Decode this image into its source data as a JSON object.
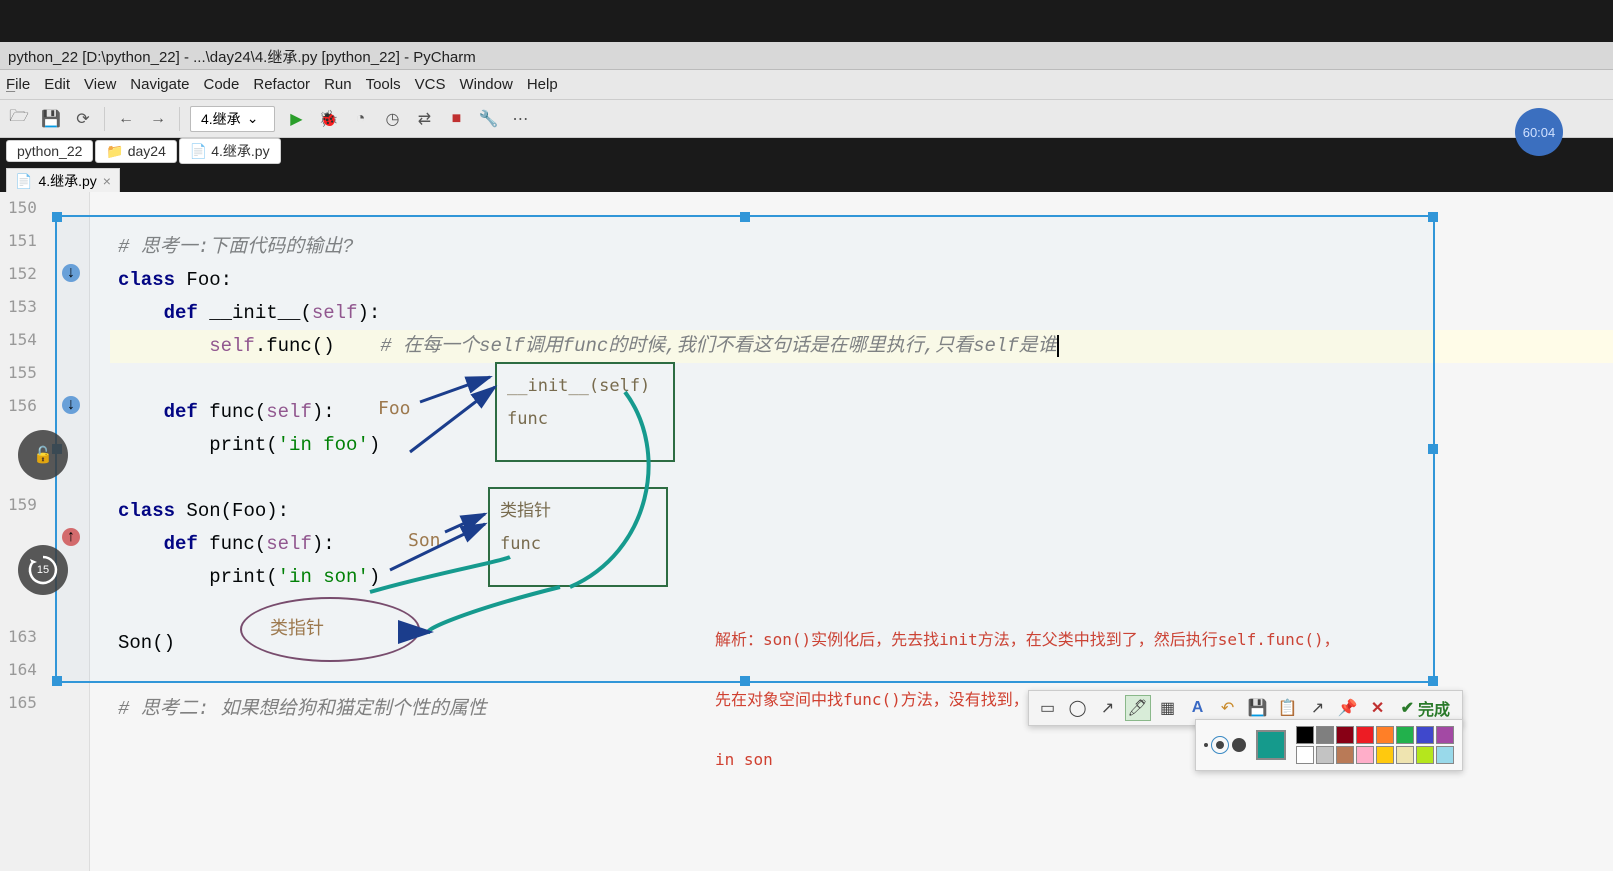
{
  "window": {
    "title": "python_22 [D:\\python_22] - ...\\day24\\4.继承.py [python_22] - PyCharm"
  },
  "menu": {
    "file": "File",
    "edit": "Edit",
    "view": "View",
    "navigate": "Navigate",
    "code": "Code",
    "refactor": "Refactor",
    "run": "Run",
    "tools": "Tools",
    "vcs": "VCS",
    "window": "Window",
    "help": "Help"
  },
  "toolbar": {
    "run_config": "4.继承"
  },
  "badge": {
    "time": "60:04"
  },
  "breadcrumbs": {
    "items": [
      "python_22",
      "day24",
      "4.继承.py"
    ]
  },
  "tabs": {
    "active": "4.继承.py"
  },
  "dim_label": "1132 × 386",
  "gutter_lines": [
    "150",
    "151",
    "152",
    "153",
    "154",
    "155",
    "156",
    "",
    "",
    "159",
    "",
    "",
    "",
    "163",
    "164",
    "165"
  ],
  "code": {
    "comment_think1": "# 思考一:下面代码的输出?",
    "class_foo": "class Foo:",
    "def_init": "    def __init__(self):",
    "self_func": "        self.func()    ",
    "self_func_cmt": "# 在每一个self调用func的时候,我们不看这句话是在哪里执行,只看self是谁",
    "def_func_foo": "    def func(self):",
    "print_foo": "        print('in foo')",
    "class_son": "class Son(Foo):",
    "def_func_son": "    def func(self):",
    "print_son": "        print('in son')",
    "son_call": "Son()",
    "comment_think2": "# 思考二: 如果想给狗和猫定制个性的属性"
  },
  "diagram": {
    "foo_label": "Foo",
    "foo_box_l1": "__init__(self)",
    "foo_box_l2": "func",
    "son_label": "Son",
    "son_box_l1": "类指针",
    "son_box_l2": "func",
    "ellipse_label": "类指针"
  },
  "annotation": {
    "line1": "解析：son()实例化后，先去找init方法，在父类中找到了，然后执行self.func()，",
    "line2": "先在对象空间中找func()方法，没有找到，然后去子类空间找，找到了----所以打印",
    "line3": "in son"
  },
  "snip": {
    "done": "完成"
  },
  "palette": {
    "current": "#159a8c",
    "colors_row1": [
      "#000000",
      "#7f7f7f",
      "#880015",
      "#ed1c24",
      "#ff7f27",
      "#22b14c",
      "#3f48cc",
      "#a349a4"
    ],
    "colors_row2": [
      "#ffffff",
      "#c3c3c3",
      "#b97a57",
      "#ffaec9",
      "#ffc90e",
      "#efe4b0",
      "#b5e61d",
      "#99d9ea"
    ]
  },
  "circ_buttons": {
    "replay_label": "15"
  }
}
